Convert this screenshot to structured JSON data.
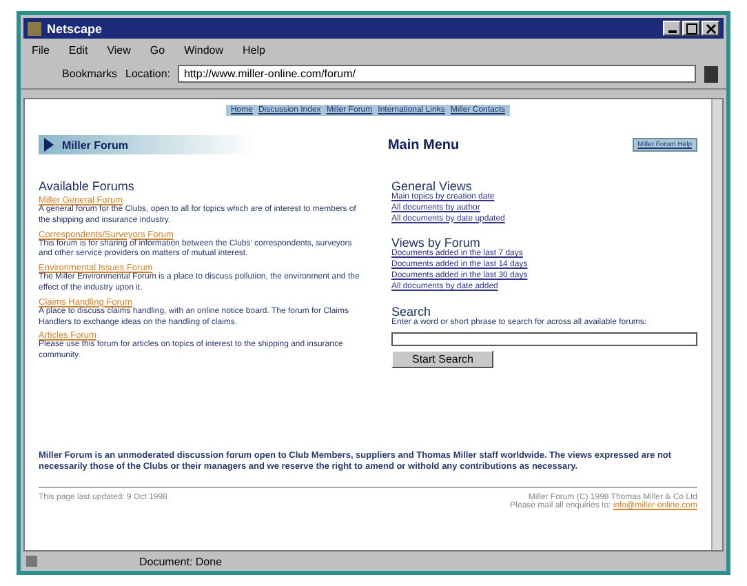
{
  "window": {
    "title": "Netscape"
  },
  "menu": [
    "File",
    "Edit",
    "View",
    "Go",
    "Window",
    "Help"
  ],
  "toolbar": {
    "bookmarks": "Bookmarks",
    "location_label": "Location:",
    "url": "http://www.miller-online.com/forum/"
  },
  "nav_links": [
    "Home",
    "Discussion Index",
    "Miller Forum",
    "International Links",
    "Miller Contacts"
  ],
  "banner": "Miller Forum",
  "heading": "Main Menu",
  "help_button": "Miller Forum Help",
  "available_forums": {
    "title": "Available Forums",
    "forums": [
      {
        "name": "Miller General Forum",
        "description": "A general forum for the Clubs, open to all for topics which are of interest to members of the shipping and insurance industry."
      },
      {
        "name": "Correspondents/Surveyors Forum",
        "description": "This forum is for sharing of information between the Clubs' correspondents, surveyors and other service providers on matters of mutual interest."
      },
      {
        "name": "Environmental Issues Forum",
        "description": "The Miller Environmental Forum is a place to discuss pollution, the environment and the effect of the industry upon it."
      },
      {
        "name": "Claims Handling Forum",
        "description": "A place to discuss claims handling, with an online notice board. The forum for Claims Handlers to exchange ideas on the handling of claims."
      },
      {
        "name": "Articles Forum",
        "description": "Please use this forum for articles on topics of interest to the shipping and insurance community."
      }
    ]
  },
  "general_views": {
    "title": "General Views",
    "links": [
      "Main topics by creation date",
      "All documents by author",
      "All documents by date updated"
    ]
  },
  "views_by_forum": {
    "title": "Views by Forum",
    "links": [
      "Documents added in the last 7 days",
      "Documents added in the last 14 days",
      "Documents added in the last 30 days",
      "All documents by date added"
    ]
  },
  "search": {
    "title": "Search",
    "prompt": "Enter a word or short phrase to search for across all available forums:",
    "button": "Start Search"
  },
  "disclaimer": "Miller Forum is an unmoderated discussion forum open to Club Members, suppliers and Thomas Miller staff worldwide. The views expressed are not necessarily those of the Clubs or their managers and we reserve the right to amend or withold any contributions as necessary.",
  "footer": {
    "updated": "This page last updated: 9 Oct 1998",
    "copyright": "Miller Forum (C) 1998 Thomas Miller & Co Ltd",
    "contact": "Please mail all enquiries to:",
    "email": "info@miller-online.com"
  },
  "status_bar": "Document: Done"
}
